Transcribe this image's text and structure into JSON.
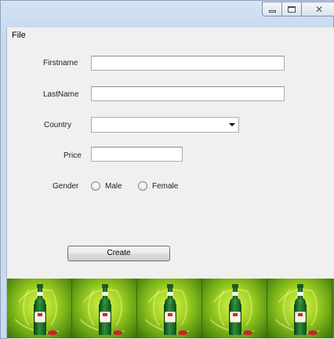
{
  "window": {
    "caption_buttons": [
      {
        "name": "minimize",
        "icon": "minimize-icon"
      },
      {
        "name": "maximize",
        "icon": "maximize-icon"
      },
      {
        "name": "close",
        "icon": "close-icon",
        "glyph": "✕"
      }
    ]
  },
  "menu": {
    "items": [
      {
        "label": "File"
      }
    ]
  },
  "form": {
    "firstname": {
      "label": "Firstname",
      "value": ""
    },
    "lastname": {
      "label": "LastName",
      "value": ""
    },
    "country": {
      "label": "Country",
      "selected": ""
    },
    "price": {
      "label": "Price",
      "value": ""
    },
    "gender": {
      "label": "Gender",
      "options": [
        {
          "label": "Male",
          "checked": false
        },
        {
          "label": "Female",
          "checked": false
        }
      ]
    },
    "create_label": "Create"
  },
  "banner": {
    "tiles": [
      {
        "image": "beer-bottle"
      },
      {
        "image": "beer-bottle"
      },
      {
        "image": "beer-bottle"
      },
      {
        "image": "beer-bottle"
      },
      {
        "image": "beer-bottle"
      }
    ],
    "colors": {
      "primary": "#a8d624",
      "dark": "#3c6d08"
    }
  }
}
